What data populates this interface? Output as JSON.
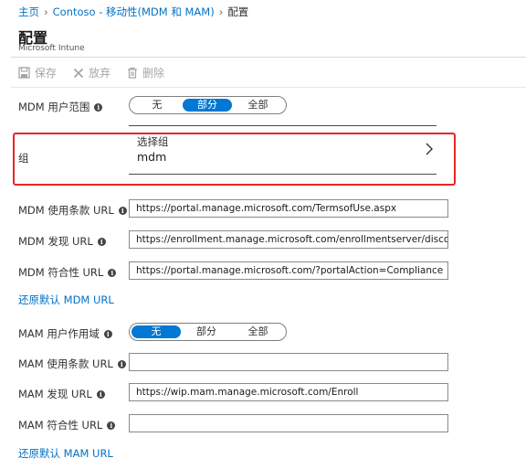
{
  "breadcrumb": {
    "home": "主页",
    "app": "Contoso - 移动性(MDM 和 MAM)",
    "current": "配置"
  },
  "header": {
    "title": "配置",
    "subtitle": "Microsoft Intune"
  },
  "toolbar": {
    "save_label": "保存",
    "discard_label": "放弃",
    "delete_label": "删除"
  },
  "mdm": {
    "scope_label": "MDM 用户范围",
    "scope_options": [
      "无",
      "部分",
      "全部"
    ],
    "scope_selected": "部分",
    "group_label": "组",
    "group_hint": "选择组",
    "group_value": "mdm",
    "terms_label": "MDM 使用条款 URL",
    "terms_value": "https://portal.manage.microsoft.com/TermsofUse.aspx",
    "discovery_label": "MDM 发现 URL",
    "discovery_value": "https://enrollment.manage.microsoft.com/enrollmentserver/discovery.svc",
    "compliance_label": "MDM 符合性 URL",
    "compliance_value": "https://portal.manage.microsoft.com/?portalAction=Compliance",
    "restore_link": "还原默认 MDM URL"
  },
  "mam": {
    "scope_label": "MAM 用户作用域",
    "scope_options": [
      "无",
      "部分",
      "全部"
    ],
    "scope_selected": "无",
    "terms_label": "MAM 使用条款 URL",
    "terms_value": "",
    "discovery_label": "MAM 发现 URL",
    "discovery_value": "https://wip.mam.manage.microsoft.com/Enroll",
    "compliance_label": "MAM 符合性 URL",
    "compliance_value": "",
    "restore_link": "还原默认 MAM URL"
  },
  "colors": {
    "accent": "#0078d4",
    "link": "#0072c6",
    "highlight_border": "#e8262a"
  },
  "icons": {
    "info": "info-icon",
    "save": "save-icon",
    "discard": "close-icon",
    "delete": "trash-icon",
    "chevron": "chevron-right-icon"
  }
}
